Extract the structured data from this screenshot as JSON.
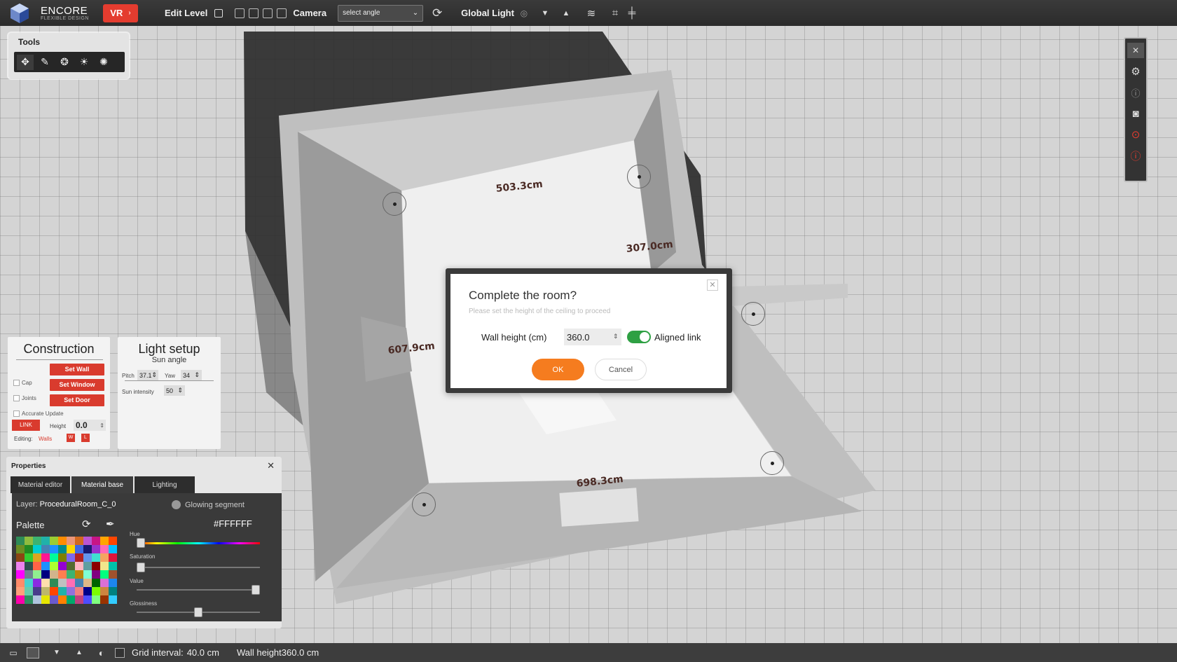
{
  "topbar": {
    "brand_name": "ENCORE",
    "brand_tagline": "FLEXIBLE DESIGN",
    "vr_label": "VR",
    "edit_level_label": "Edit Level",
    "camera_label": "Camera",
    "camera_select_value": "select angle",
    "global_light_label": "Global Light"
  },
  "scene": {
    "dimension_labels": [
      "503.3cm",
      "307.0cm",
      "607.9cm",
      "698.3cm"
    ]
  },
  "tools": {
    "title": "Tools"
  },
  "construction": {
    "title": "Construction",
    "set_wall": "Set Wall",
    "set_window": "Set Window",
    "set_door": "Set Door",
    "cap_label": "Cap",
    "joints_label": "Joints",
    "accurate_update_label": "Accurate Update",
    "link_label": "LINK",
    "height_label": "Height",
    "height_value": "0.0",
    "editing_label": "Editing:",
    "editing_value": "Walls",
    "w_label": "W",
    "l_label": "L"
  },
  "light_setup": {
    "title": "Light setup",
    "subtitle": "Sun angle",
    "pitch_label": "Pitch",
    "pitch_value": "37.1",
    "yaw_label": "Yaw",
    "yaw_value": "34",
    "sun_intensity_label": "Sun intensity",
    "sun_intensity_value": "50"
  },
  "properties": {
    "title": "Properties",
    "tabs": [
      "Material editor",
      "Material base",
      "Lighting"
    ],
    "layer_label": "Layer:",
    "layer_value": "ProceduralRoom_C_0",
    "glowing_segment_label": "Glowing segment",
    "palette_label": "Palette",
    "hex_value": "#FFFFFF",
    "hue_label": "Hue",
    "saturation_label": "Saturation",
    "value_label": "Value",
    "glossiness_label": "Glossiness",
    "hue_level": 0.0,
    "saturation_level": 0.0,
    "value_level": 1.0,
    "glossiness_level": 0.5,
    "palette_colors": [
      "#2e8b57",
      "#8fbc3f",
      "#3cb371",
      "#20b2aa",
      "#9acd32",
      "#ff8c00",
      "#e9967a",
      "#d2691e",
      "#ba55d3",
      "#c71585",
      "#ffa500",
      "#ff4500",
      "#6b8e23",
      "#228b22",
      "#00ced1",
      "#4682b4",
      "#1e90ff",
      "#008b8b",
      "#ffd700",
      "#4169e1",
      "#191970",
      "#9932cc",
      "#ff69b4",
      "#00bfff",
      "#8b4513",
      "#32cd32",
      "#daa520",
      "#ff1493",
      "#00fa9a",
      "#808000",
      "#7b68ee",
      "#b22222",
      "#6495ed",
      "#40e0d0",
      "#f4a460",
      "#dc143c",
      "#ee82ee",
      "#2f4f4f",
      "#ff6347",
      "#1e90ff",
      "#adff2f",
      "#9400d3",
      "#556b2f",
      "#ffb6c1",
      "#5f9ea0",
      "#8b0000",
      "#f0e68c",
      "#00c2a8",
      "#ff00ff",
      "#708090",
      "#90ee90",
      "#000080",
      "#d2b48c",
      "#ff7f50",
      "#3cb371",
      "#b8860b",
      "#7fffd4",
      "#800080",
      "#00ff7f",
      "#a0522d",
      "#ff8c69",
      "#48d1cc",
      "#8a2be2",
      "#ffdead",
      "#2e8b57",
      "#c0c0c0",
      "#ff6eb4",
      "#4682b4",
      "#deb887",
      "#006400",
      "#da70d6",
      "#1c86ee",
      "#ffa07a",
      "#66cdaa",
      "#483d8b",
      "#bdb76b",
      "#ff4500",
      "#20b2aa",
      "#9370db",
      "#f08080",
      "#00008b",
      "#7cfc00",
      "#cd853f",
      "#008080",
      "#ff00aa",
      "#2f8f5f",
      "#b0c4de",
      "#e6e600",
      "#6a5acd",
      "#ff8000",
      "#00a86b",
      "#c04080",
      "#4d4dff",
      "#80ff80",
      "#993300",
      "#33ccff"
    ]
  },
  "statusbar": {
    "grid_interval_label": "Grid interval:",
    "grid_interval_value": "40.0 cm",
    "wall_height_label": "Wall height",
    "wall_height_value": "360.0 cm"
  },
  "dialog": {
    "title": "Complete the room?",
    "subtitle": "Please set the height of the ceiling to proceed",
    "wall_height_label": "Wall height (cm)",
    "wall_height_value": "360.0",
    "aligned_link_label": "Aligned link",
    "aligned_link_on": true,
    "ok_label": "OK",
    "cancel_label": "Cancel"
  },
  "icons": {
    "logo": "hexagon-logo-icon",
    "refresh": "refresh-icon",
    "layers": "layers-icon",
    "close": "close-icon",
    "settings": "gear-icon",
    "camera": "camera-icon"
  },
  "colors": {
    "accent_red": "#d93b2e",
    "ok_orange": "#f57c1f",
    "toggle_green": "#2ea043",
    "toolbar_dark": "#2b2b2b"
  }
}
